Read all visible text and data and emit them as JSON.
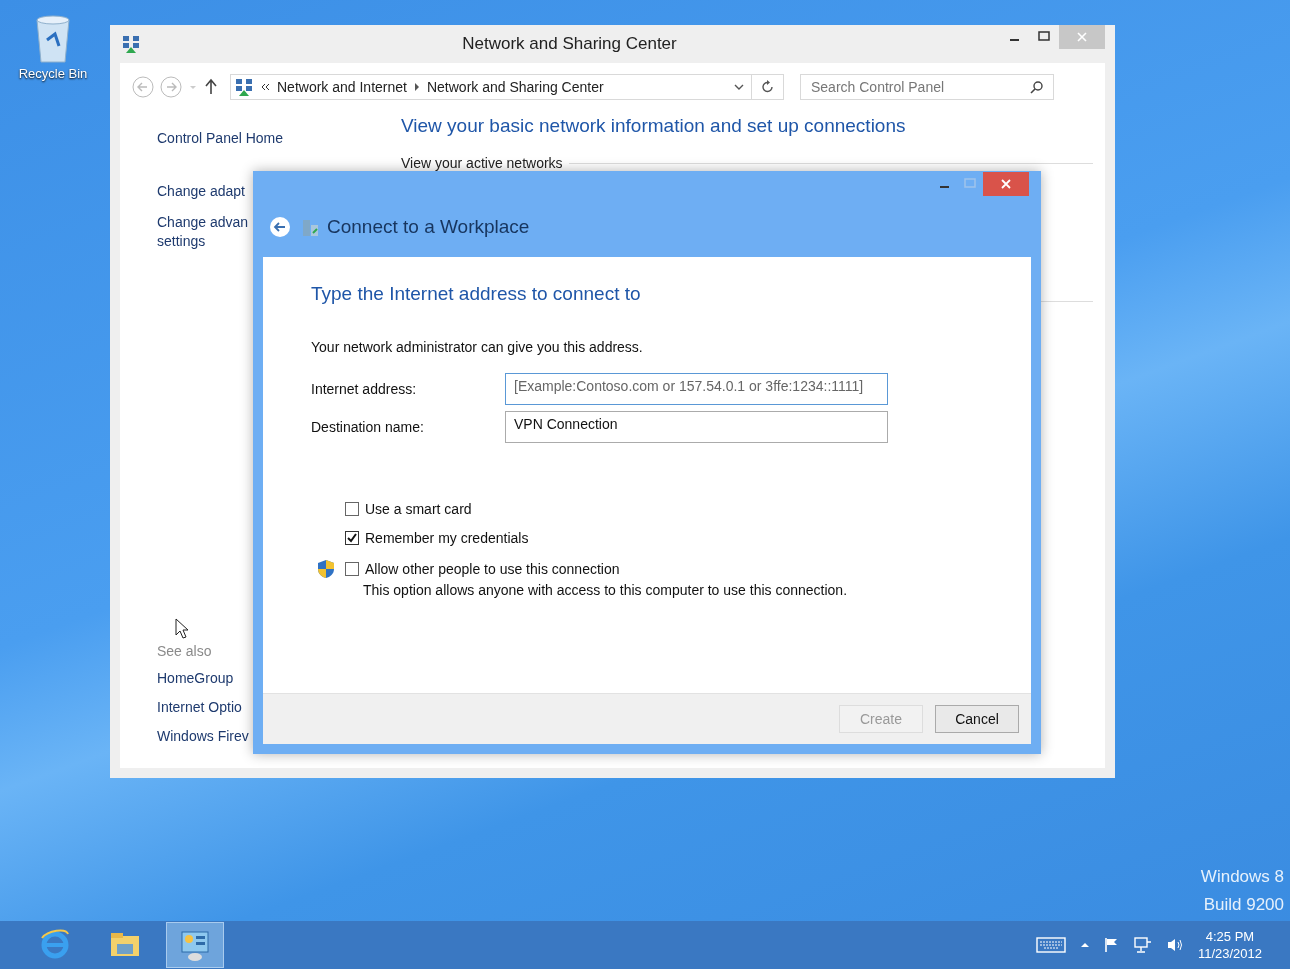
{
  "desktop": {
    "icons": [
      {
        "label": "Recycle Bin"
      }
    ],
    "build_info": [
      "Windows 8",
      "Build 9200"
    ]
  },
  "main_window": {
    "title": "Network and Sharing Center",
    "address_bar": {
      "crumbs": [
        "Network and Internet",
        "Network and Sharing Center"
      ]
    },
    "search": {
      "placeholder": "Search Control Panel"
    },
    "sidebar": {
      "items": [
        {
          "lines": [
            "Control Panel Home"
          ]
        },
        {
          "lines": [
            "Change adapt"
          ]
        },
        {
          "lines": [
            "Change advan",
            "settings"
          ]
        }
      ],
      "see_also_label": "See also",
      "see_also": [
        "HomeGroup",
        "Internet Optio",
        "Windows Firev"
      ]
    },
    "heading": "View your basic network information and set up connections",
    "section_title": "View your active networks"
  },
  "dialog": {
    "title": "Connect to a Workplace",
    "heading": "Type the Internet address to connect to",
    "intro": "Your network administrator can give you this address.",
    "fields": [
      {
        "label": "Internet address:",
        "placeholder": "[Example:Contoso.com or 157.54.0.1 or 3ffe:1234::1111]",
        "focused": true
      },
      {
        "label": "Destination name:",
        "value": "VPN Connection",
        "focused": false
      }
    ],
    "options": [
      {
        "label": "Use a smart card",
        "checked": false,
        "shield": false
      },
      {
        "label": "Remember my credentials",
        "checked": true,
        "shield": false
      },
      {
        "label": "Allow other people to use this connection",
        "checked": false,
        "shield": true,
        "note": "This option allows anyone with access to this computer to use this connection."
      }
    ],
    "buttons": [
      {
        "label": "Create",
        "disabled": true
      },
      {
        "label": "Cancel",
        "disabled": false
      }
    ]
  },
  "taskbar": {
    "apps": [
      {
        "kind": "browser",
        "selected": false
      },
      {
        "kind": "folder",
        "selected": false
      },
      {
        "kind": "control-panel",
        "selected": true
      }
    ],
    "clock": {
      "time": "4:25 PM",
      "date": "11/23/2012"
    }
  }
}
